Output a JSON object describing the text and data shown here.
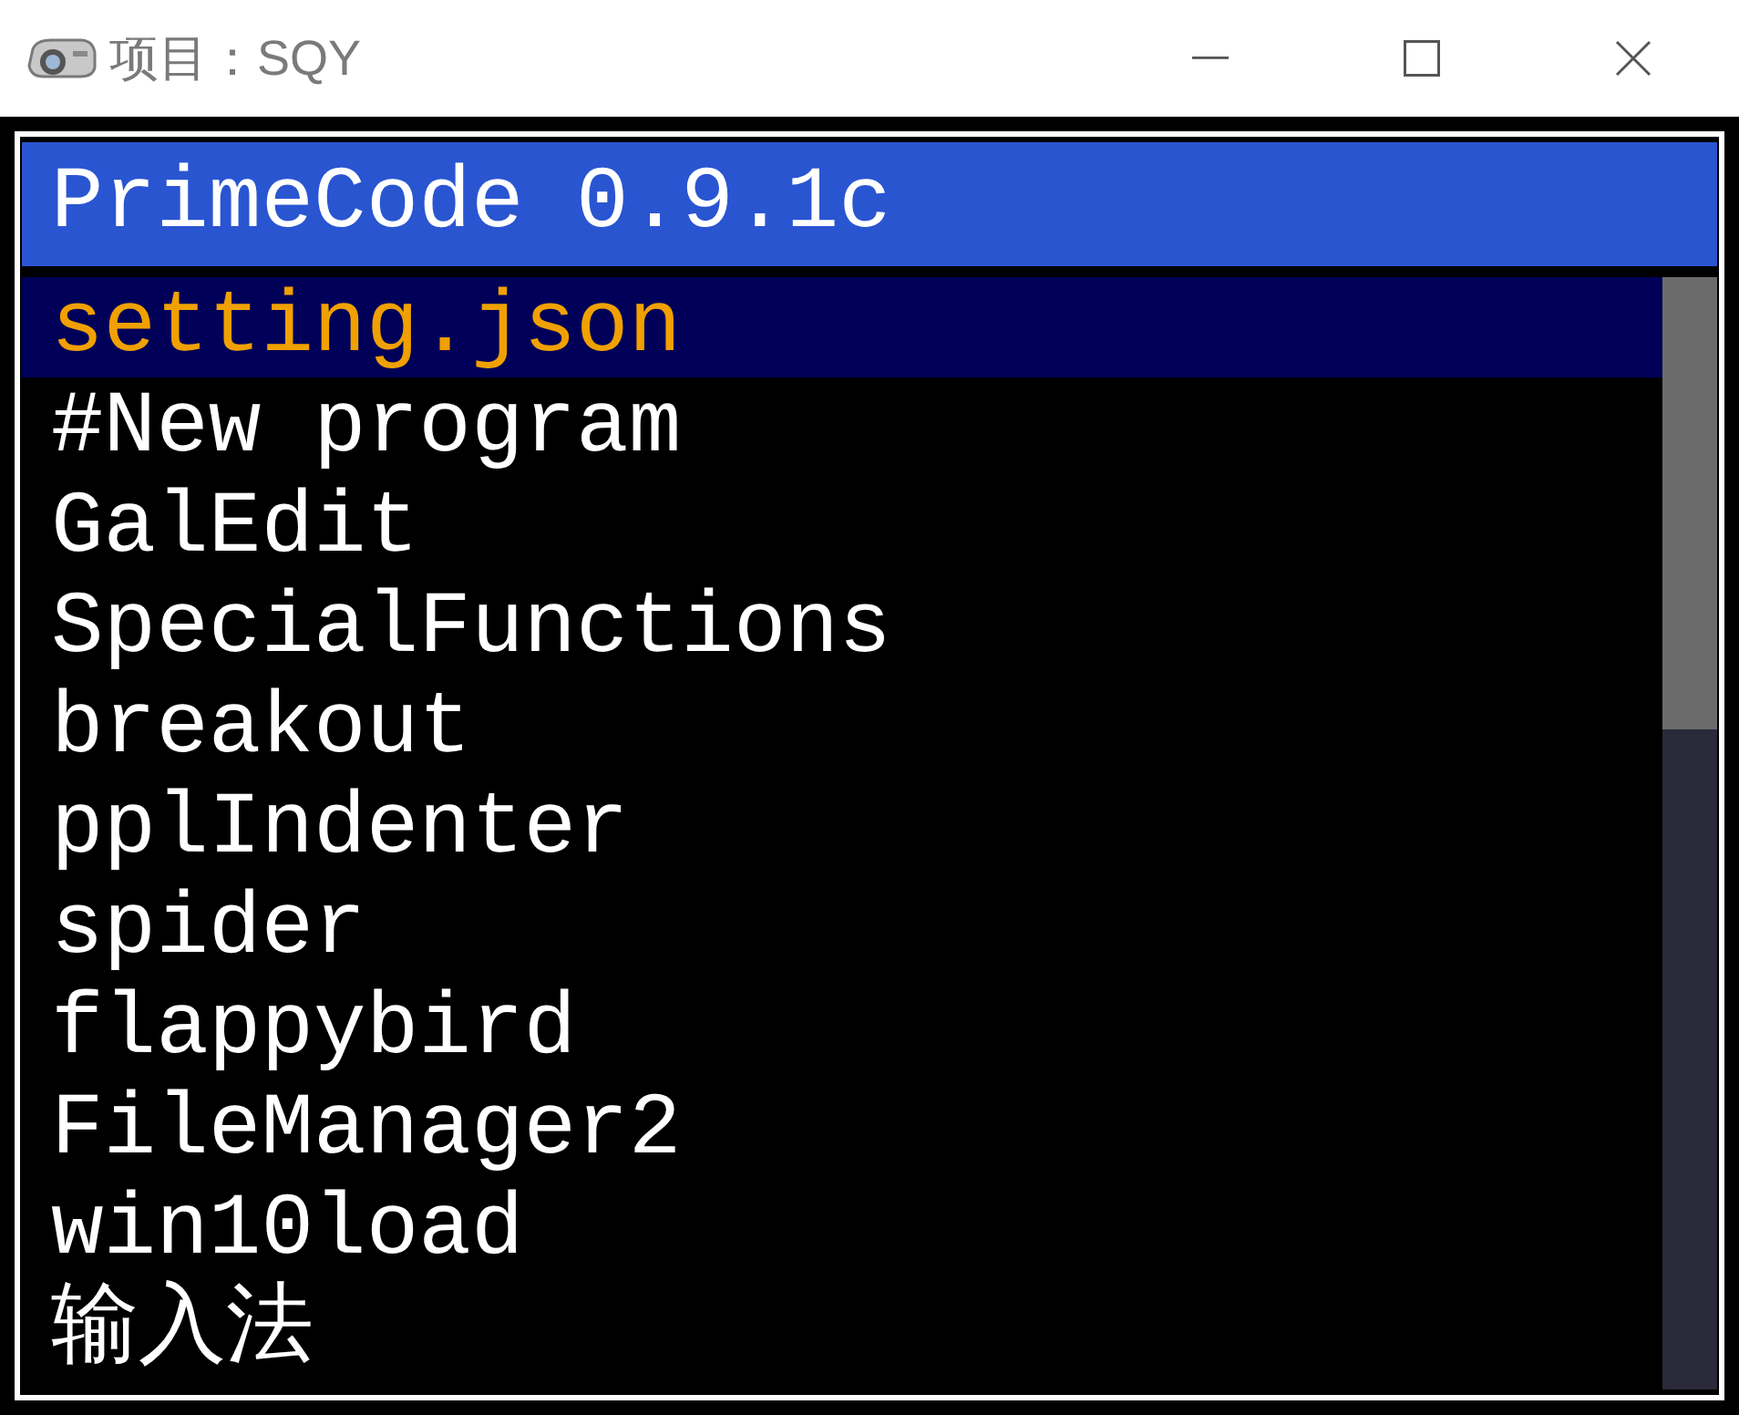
{
  "window": {
    "title": "项目：SQY"
  },
  "app": {
    "header": "PrimeCode 0.9.1c",
    "files": [
      {
        "name": "setting.json",
        "selected": true
      },
      {
        "name": "#New program",
        "selected": false
      },
      {
        "name": "GalEdit",
        "selected": false
      },
      {
        "name": "SpecialFunctions",
        "selected": false
      },
      {
        "name": "breakout",
        "selected": false
      },
      {
        "name": "pplIndenter",
        "selected": false
      },
      {
        "name": "spider",
        "selected": false
      },
      {
        "name": "flappybird",
        "selected": false
      },
      {
        "name": "FileManager2",
        "selected": false
      },
      {
        "name": "win10load",
        "selected": false
      },
      {
        "name": "输入法",
        "selected": false
      }
    ]
  }
}
